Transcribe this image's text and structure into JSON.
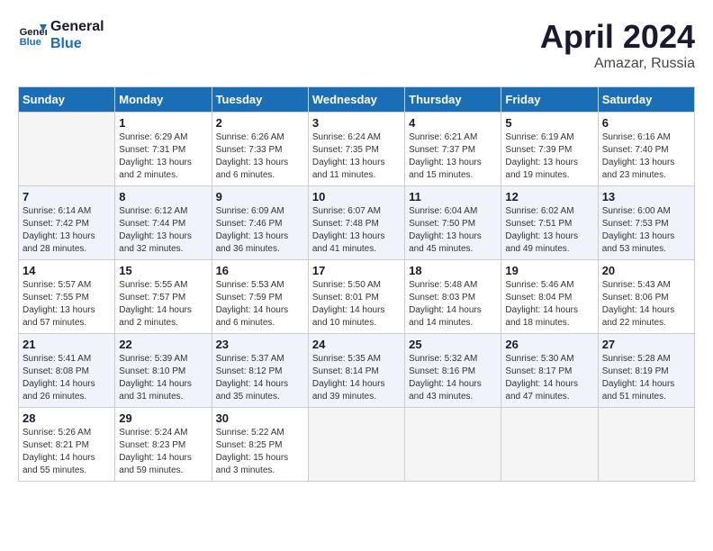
{
  "logo": {
    "line1": "General",
    "line2": "Blue"
  },
  "title": "April 2024",
  "location": "Amazar, Russia",
  "days_of_week": [
    "Sunday",
    "Monday",
    "Tuesday",
    "Wednesday",
    "Thursday",
    "Friday",
    "Saturday"
  ],
  "weeks": [
    [
      {
        "day": "",
        "empty": true
      },
      {
        "day": "1",
        "sunrise": "6:29 AM",
        "sunset": "7:31 PM",
        "daylight": "13 hours and 2 minutes."
      },
      {
        "day": "2",
        "sunrise": "6:26 AM",
        "sunset": "7:33 PM",
        "daylight": "13 hours and 6 minutes."
      },
      {
        "day": "3",
        "sunrise": "6:24 AM",
        "sunset": "7:35 PM",
        "daylight": "13 hours and 11 minutes."
      },
      {
        "day": "4",
        "sunrise": "6:21 AM",
        "sunset": "7:37 PM",
        "daylight": "13 hours and 15 minutes."
      },
      {
        "day": "5",
        "sunrise": "6:19 AM",
        "sunset": "7:39 PM",
        "daylight": "13 hours and 19 minutes."
      },
      {
        "day": "6",
        "sunrise": "6:16 AM",
        "sunset": "7:40 PM",
        "daylight": "13 hours and 23 minutes."
      }
    ],
    [
      {
        "day": "7",
        "sunrise": "6:14 AM",
        "sunset": "7:42 PM",
        "daylight": "13 hours and 28 minutes."
      },
      {
        "day": "8",
        "sunrise": "6:12 AM",
        "sunset": "7:44 PM",
        "daylight": "13 hours and 32 minutes."
      },
      {
        "day": "9",
        "sunrise": "6:09 AM",
        "sunset": "7:46 PM",
        "daylight": "13 hours and 36 minutes."
      },
      {
        "day": "10",
        "sunrise": "6:07 AM",
        "sunset": "7:48 PM",
        "daylight": "13 hours and 41 minutes."
      },
      {
        "day": "11",
        "sunrise": "6:04 AM",
        "sunset": "7:50 PM",
        "daylight": "13 hours and 45 minutes."
      },
      {
        "day": "12",
        "sunrise": "6:02 AM",
        "sunset": "7:51 PM",
        "daylight": "13 hours and 49 minutes."
      },
      {
        "day": "13",
        "sunrise": "6:00 AM",
        "sunset": "7:53 PM",
        "daylight": "13 hours and 53 minutes."
      }
    ],
    [
      {
        "day": "14",
        "sunrise": "5:57 AM",
        "sunset": "7:55 PM",
        "daylight": "13 hours and 57 minutes."
      },
      {
        "day": "15",
        "sunrise": "5:55 AM",
        "sunset": "7:57 PM",
        "daylight": "14 hours and 2 minutes."
      },
      {
        "day": "16",
        "sunrise": "5:53 AM",
        "sunset": "7:59 PM",
        "daylight": "14 hours and 6 minutes."
      },
      {
        "day": "17",
        "sunrise": "5:50 AM",
        "sunset": "8:01 PM",
        "daylight": "14 hours and 10 minutes."
      },
      {
        "day": "18",
        "sunrise": "5:48 AM",
        "sunset": "8:03 PM",
        "daylight": "14 hours and 14 minutes."
      },
      {
        "day": "19",
        "sunrise": "5:46 AM",
        "sunset": "8:04 PM",
        "daylight": "14 hours and 18 minutes."
      },
      {
        "day": "20",
        "sunrise": "5:43 AM",
        "sunset": "8:06 PM",
        "daylight": "14 hours and 22 minutes."
      }
    ],
    [
      {
        "day": "21",
        "sunrise": "5:41 AM",
        "sunset": "8:08 PM",
        "daylight": "14 hours and 26 minutes."
      },
      {
        "day": "22",
        "sunrise": "5:39 AM",
        "sunset": "8:10 PM",
        "daylight": "14 hours and 31 minutes."
      },
      {
        "day": "23",
        "sunrise": "5:37 AM",
        "sunset": "8:12 PM",
        "daylight": "14 hours and 35 minutes."
      },
      {
        "day": "24",
        "sunrise": "5:35 AM",
        "sunset": "8:14 PM",
        "daylight": "14 hours and 39 minutes."
      },
      {
        "day": "25",
        "sunrise": "5:32 AM",
        "sunset": "8:16 PM",
        "daylight": "14 hours and 43 minutes."
      },
      {
        "day": "26",
        "sunrise": "5:30 AM",
        "sunset": "8:17 PM",
        "daylight": "14 hours and 47 minutes."
      },
      {
        "day": "27",
        "sunrise": "5:28 AM",
        "sunset": "8:19 PM",
        "daylight": "14 hours and 51 minutes."
      }
    ],
    [
      {
        "day": "28",
        "sunrise": "5:26 AM",
        "sunset": "8:21 PM",
        "daylight": "14 hours and 55 minutes."
      },
      {
        "day": "29",
        "sunrise": "5:24 AM",
        "sunset": "8:23 PM",
        "daylight": "14 hours and 59 minutes."
      },
      {
        "day": "30",
        "sunrise": "5:22 AM",
        "sunset": "8:25 PM",
        "daylight": "15 hours and 3 minutes."
      },
      {
        "day": "",
        "empty": true
      },
      {
        "day": "",
        "empty": true
      },
      {
        "day": "",
        "empty": true
      },
      {
        "day": "",
        "empty": true
      }
    ]
  ]
}
